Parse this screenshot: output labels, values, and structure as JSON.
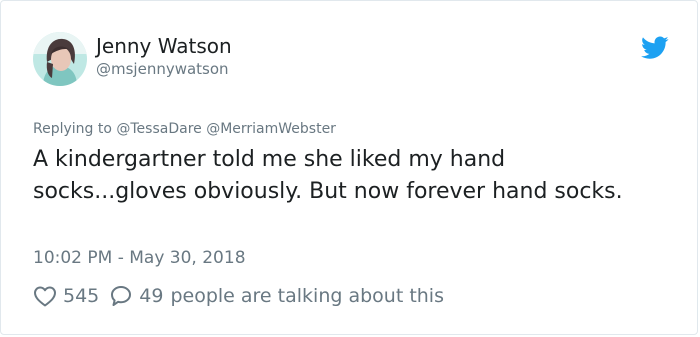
{
  "user": {
    "display_name": "Jenny Watson",
    "handle": "@msjennywatson",
    "avatar_icon": "profile-photo"
  },
  "header": {
    "brand_icon": "twitter-bird-icon",
    "brand_color": "#1da1f2"
  },
  "replying_to": "Replying to @TessaDare @MerriamWebster",
  "tweet": {
    "text": "A kindergartner told me she liked my hand socks...gloves obviously. But now forever hand socks.",
    "timestamp": "10:02 PM - May 30, 2018"
  },
  "actions": {
    "likes": "545",
    "replies": "49",
    "talking_label": "people are talking about this"
  },
  "colors": {
    "text": "#1c2022",
    "secondary": "#697882",
    "border": "#e1e8ed"
  }
}
